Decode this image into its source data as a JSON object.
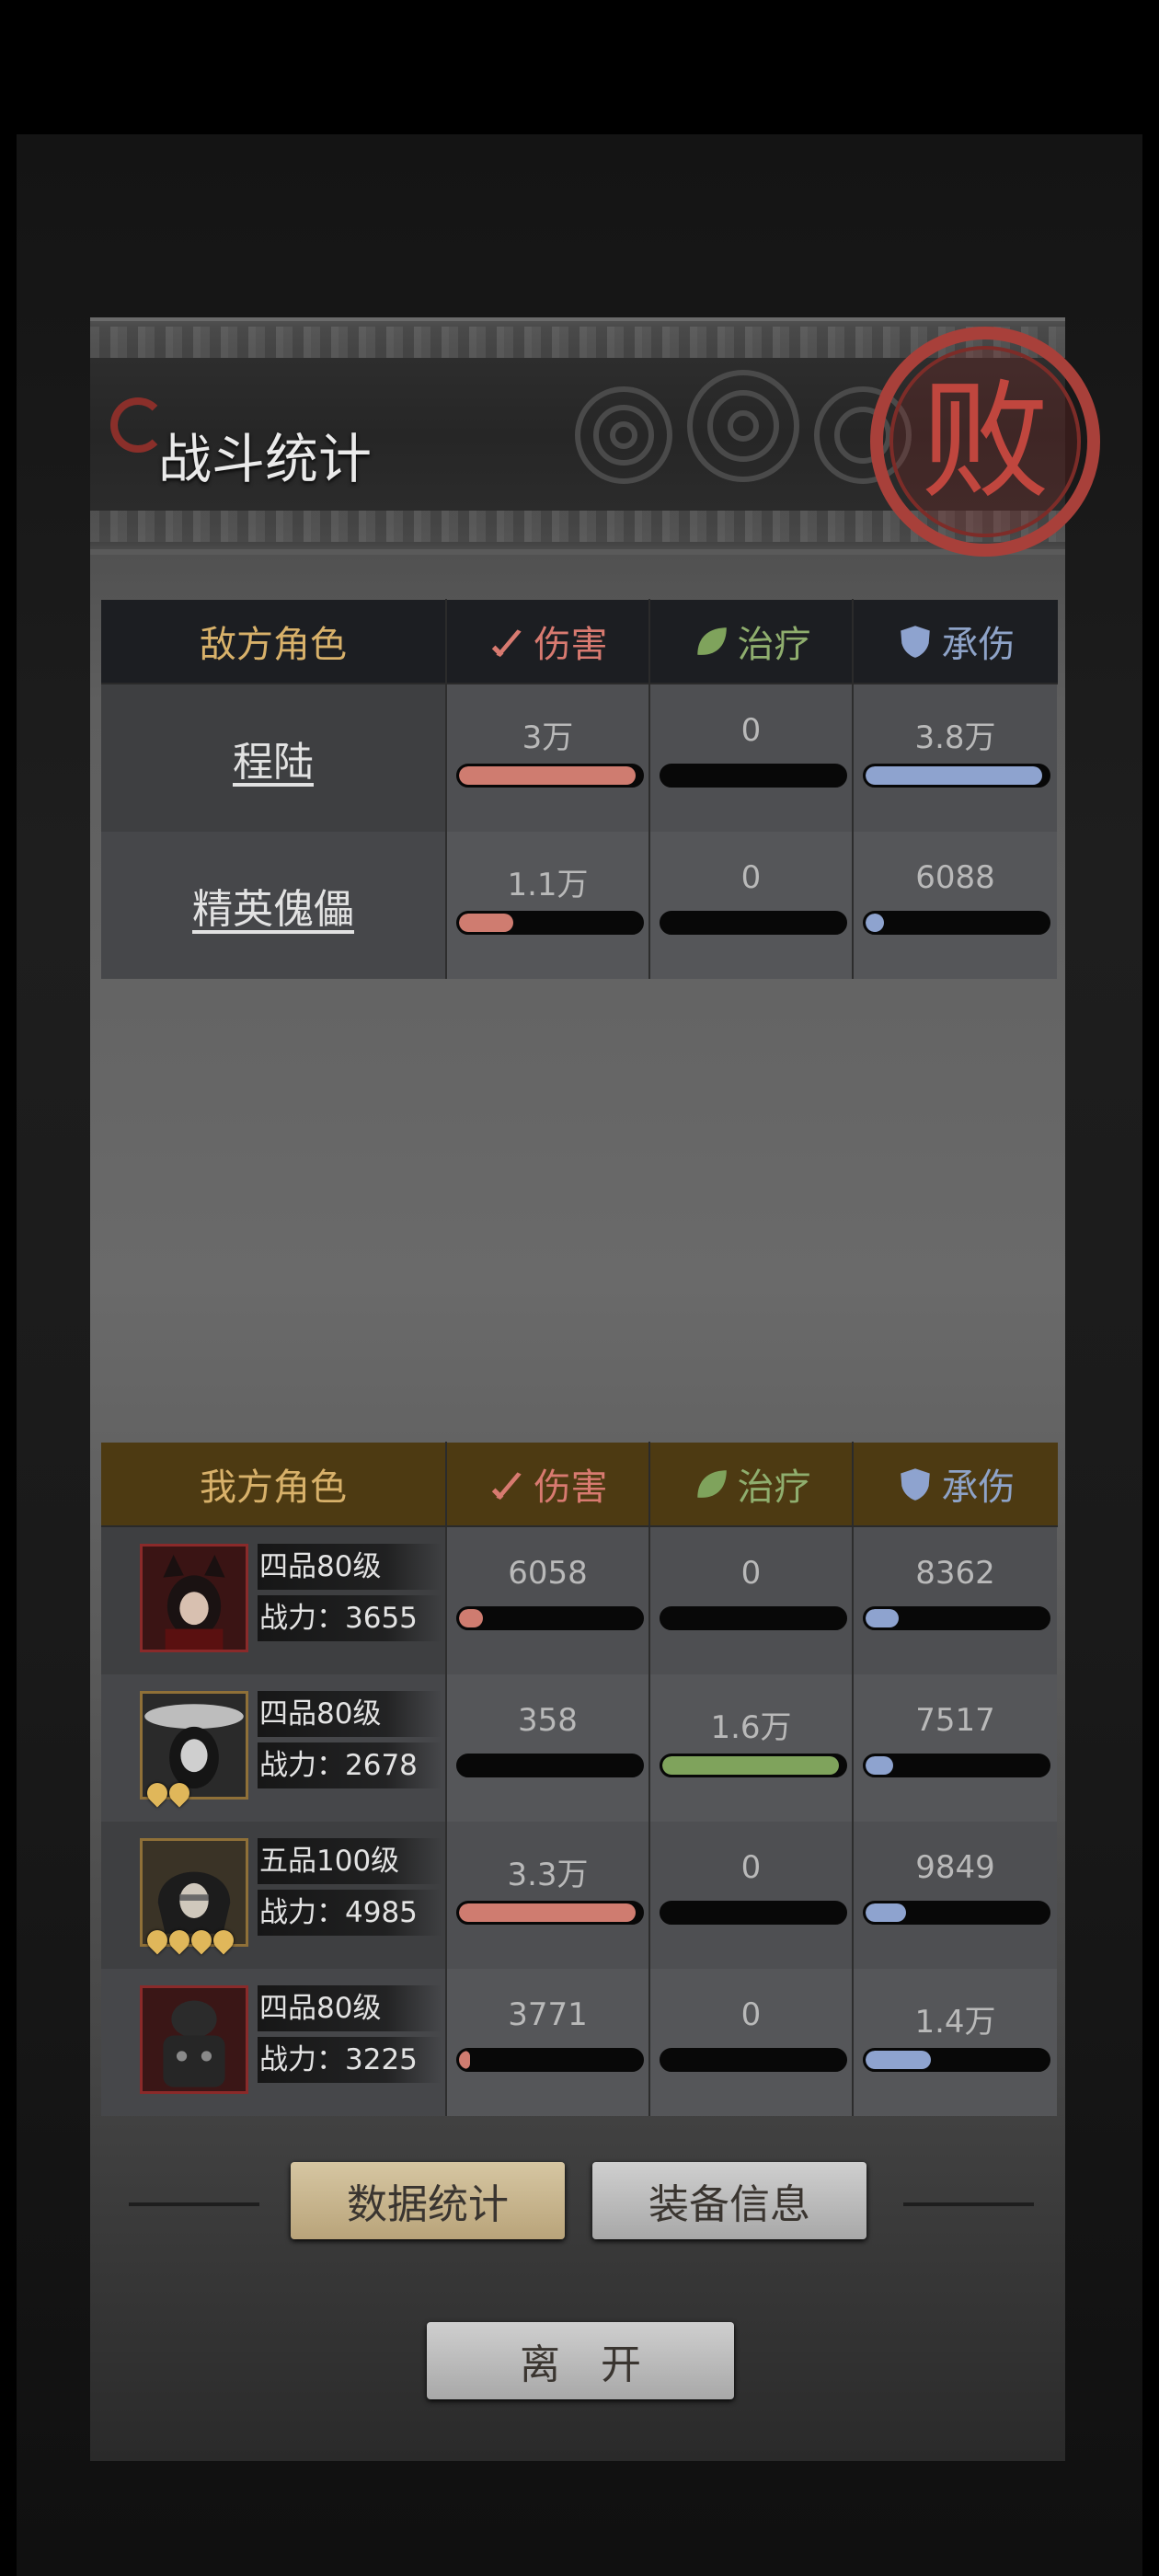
{
  "header": {
    "title": "战斗统计",
    "seal_text": "败"
  },
  "enemy_table": {
    "headers": {
      "name": "敌方角色",
      "damage": "伤害",
      "healing": "治疗",
      "damage_taken": "承伤"
    },
    "rows": [
      {
        "name": "程陆",
        "damage": "3万",
        "damage_fill": 0.97,
        "healing": "0",
        "healing_fill": 0,
        "taken": "3.8万",
        "taken_fill": 0.97
      },
      {
        "name": "精英傀儡",
        "damage": "1.1万",
        "damage_fill": 0.3,
        "healing": "0",
        "healing_fill": 0,
        "taken": "6088",
        "taken_fill": 0.1
      }
    ]
  },
  "ally_table": {
    "headers": {
      "name": "我方角色",
      "damage": "伤害",
      "healing": "治疗",
      "damage_taken": "承伤"
    },
    "rows": [
      {
        "rank": "四品80级",
        "power": "战力：3655",
        "stars": 0,
        "damage": "6058",
        "damage_fill": 0.13,
        "healing": "0",
        "healing_fill": 0,
        "taken": "8362",
        "taken_fill": 0.18
      },
      {
        "rank": "四品80级",
        "power": "战力：2678",
        "stars": 2,
        "damage": "358",
        "damage_fill": 0,
        "healing": "1.6万",
        "healing_fill": 0.97,
        "taken": "7517",
        "taken_fill": 0.15
      },
      {
        "rank": "五品100级",
        "power": "战力：4985",
        "stars": 4,
        "damage": "3.3万",
        "damage_fill": 0.97,
        "healing": "0",
        "healing_fill": 0,
        "taken": "9849",
        "taken_fill": 0.22
      },
      {
        "rank": "四品80级",
        "power": "战力：3225",
        "stars": 0,
        "damage": "3771",
        "damage_fill": 0.06,
        "healing": "0",
        "healing_fill": 0,
        "taken": "1.4万",
        "taken_fill": 0.36
      }
    ]
  },
  "buttons": {
    "stats": "数据统计",
    "equipment": "装备信息",
    "leave": "离　开"
  },
  "colors": {
    "damage": "#cf7c70",
    "healing": "#7fa35c",
    "taken": "#8ea3cf",
    "enemy_header": "#1c1e22",
    "ally_header": "#4d3a12"
  },
  "icons": {
    "damage": "sword-icon",
    "healing": "leaf-icon",
    "taken": "shield-icon"
  }
}
